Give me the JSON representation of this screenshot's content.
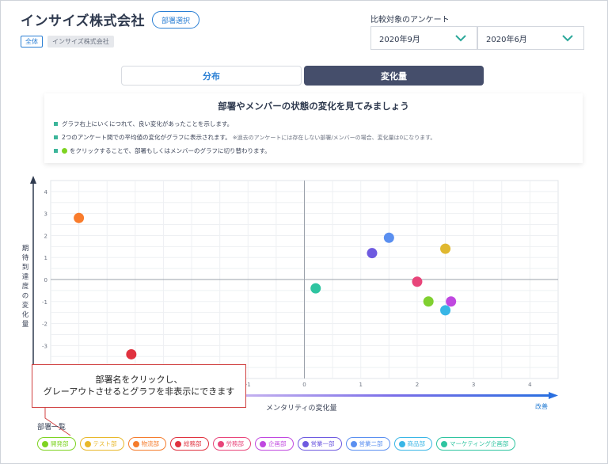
{
  "header": {
    "company_name": "インサイズ株式会社",
    "dept_select_label": "部署選択",
    "tag_all": "全体",
    "tag_company": "インサイズ株式会社"
  },
  "compare": {
    "label": "比較対象のアンケート",
    "select1_value": "2020年9月",
    "select2_value": "2020年6月",
    "accent": "#2ba89a"
  },
  "tabs": [
    {
      "label": "分布",
      "active": false
    },
    {
      "label": "変化量",
      "active": true
    }
  ],
  "info": {
    "title": "部署やメンバーの状態の変化を見てみましょう",
    "line1": "グラフ右上にいくにつれて、良い変化があったことを示します。",
    "line2": "2つのアンケート間での平均値の変化がグラフに表示されます。",
    "line2_note": "※過去のアンケートには存在しない部署/メンバーの場合、変化量は0になります。",
    "line3": "をクリックすることで、部署もしくはメンバーのグラフに切り替わります。"
  },
  "chart_data": {
    "type": "scatter",
    "xlabel": "メンタリティの変化量",
    "ylabel": "期待到達度の変化量",
    "xlim": [
      -4.5,
      4.5
    ],
    "ylim": [
      -4.5,
      4.5
    ],
    "x_ticks": [
      -1,
      0,
      1,
      2,
      3,
      4
    ],
    "y_ticks": [
      4,
      3,
      2,
      1,
      0,
      -1,
      -2,
      -3
    ],
    "improve_label": "改善",
    "grid": true,
    "points": [
      {
        "x": -4.0,
        "y": 2.8,
        "color": "#f97c2c"
      },
      {
        "x": -3.07,
        "y": -3.4,
        "color": "#e0323f"
      },
      {
        "x": 0.2,
        "y": -0.4,
        "color": "#2ec4a0"
      },
      {
        "x": 1.2,
        "y": 1.2,
        "color": "#6e5ae0"
      },
      {
        "x": 1.5,
        "y": 1.9,
        "color": "#5a8ff0"
      },
      {
        "x": 2.0,
        "y": -0.1,
        "color": "#e8457a"
      },
      {
        "x": 2.5,
        "y": 1.4,
        "color": "#e0b830"
      },
      {
        "x": 2.2,
        "y": -1.0,
        "color": "#80d030"
      },
      {
        "x": 2.6,
        "y": -1.0,
        "color": "#c048e0"
      },
      {
        "x": 2.5,
        "y": -1.4,
        "color": "#38b6e6"
      }
    ]
  },
  "callout": {
    "line1": "部署名をクリックし、",
    "line2": "グレーアウトさせるとグラフを非表示にできます"
  },
  "dept_list": {
    "label": "部署一覧",
    "items": [
      {
        "label": "開発部",
        "color": "#7ed321"
      },
      {
        "label": "テスト部",
        "color": "#e8b82a"
      },
      {
        "label": "物流部",
        "color": "#f57c2c"
      },
      {
        "label": "総務部",
        "color": "#e0323f"
      },
      {
        "label": "労務部",
        "color": "#e8457a"
      },
      {
        "label": "企画部",
        "color": "#c048e0"
      },
      {
        "label": "営業一部",
        "color": "#6e5ae0"
      },
      {
        "label": "営業二部",
        "color": "#5a8ff0"
      },
      {
        "label": "商品部",
        "color": "#38b6e6"
      },
      {
        "label": "マーケティング企画部",
        "color": "#2ec4a0"
      }
    ]
  }
}
